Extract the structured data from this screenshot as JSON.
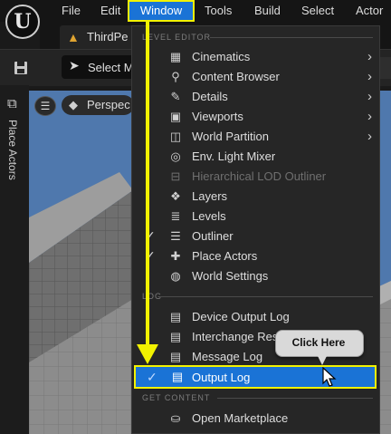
{
  "menubar": {
    "items": [
      "File",
      "Edit",
      "Window",
      "Tools",
      "Build",
      "Select",
      "Actor"
    ],
    "active": "Window"
  },
  "tab": {
    "label": "ThirdPe"
  },
  "toolbar": {
    "select_mode": "Select M"
  },
  "left_panel": {
    "place_actors": "Place Actors"
  },
  "viewport": {
    "perspective": "Perspec"
  },
  "window_menu": {
    "sections": {
      "level_editor": "LEVEL EDITOR",
      "log": "LOG",
      "get_content": "GET CONTENT"
    },
    "level_editor_items": [
      {
        "label": "Cinematics",
        "icon": "cinematics-icon",
        "submenu": true
      },
      {
        "label": "Content Browser",
        "icon": "content-browser-icon",
        "submenu": true
      },
      {
        "label": "Details",
        "icon": "details-icon",
        "submenu": true
      },
      {
        "label": "Viewports",
        "icon": "viewports-icon",
        "submenu": true
      },
      {
        "label": "World Partition",
        "icon": "world-partition-icon",
        "submenu": true
      },
      {
        "label": "Env. Light Mixer",
        "icon": "light-mixer-icon",
        "submenu": false
      },
      {
        "label": "Hierarchical LOD Outliner",
        "icon": "hlod-icon",
        "submenu": false,
        "disabled": true
      },
      {
        "label": "Layers",
        "icon": "layers-icon",
        "submenu": false
      },
      {
        "label": "Levels",
        "icon": "levels-icon",
        "submenu": false
      },
      {
        "label": "Outliner",
        "icon": "outliner-icon",
        "submenu": false,
        "checked": true
      },
      {
        "label": "Place Actors",
        "icon": "place-actors-icon",
        "submenu": false,
        "checked": true
      },
      {
        "label": "World Settings",
        "icon": "world-settings-icon",
        "submenu": false
      }
    ],
    "log_items": [
      {
        "label": "Device Output Log",
        "icon": "device-output-log-icon"
      },
      {
        "label": "Interchange Res",
        "icon": "interchange-icon"
      },
      {
        "label": "Message Log",
        "icon": "message-log-icon"
      },
      {
        "label": "Output Log",
        "icon": "output-log-icon",
        "checked": true,
        "highlighted": true
      }
    ],
    "get_content_items": [
      {
        "label": "Open Marketplace",
        "icon": "marketplace-icon"
      }
    ]
  },
  "annotation": {
    "callout": "Click Here"
  },
  "colors": {
    "highlight": "#1a73d6",
    "annotation": "#f2f200",
    "menu_bg": "#262626"
  }
}
